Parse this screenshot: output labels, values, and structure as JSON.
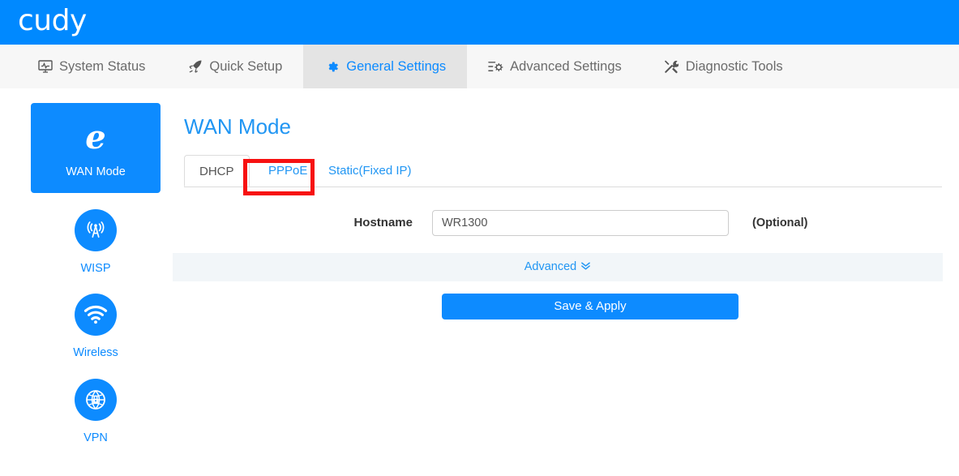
{
  "brand": {
    "name": "cudy"
  },
  "nav": {
    "items": [
      {
        "label": "System Status",
        "icon": "monitor-pulse-icon",
        "active": false
      },
      {
        "label": "Quick Setup",
        "icon": "rocket-icon",
        "active": false
      },
      {
        "label": "General Settings",
        "icon": "gear-icon",
        "active": true
      },
      {
        "label": "Advanced Settings",
        "icon": "sliders-gear-icon",
        "active": false
      },
      {
        "label": "Diagnostic Tools",
        "icon": "wrench-screwdriver-icon",
        "active": false
      }
    ]
  },
  "sidebar": {
    "items": [
      {
        "label": "WAN Mode",
        "icon": "browser-e-icon",
        "active": true
      },
      {
        "label": "WISP",
        "icon": "antenna-icon",
        "active": false
      },
      {
        "label": "Wireless",
        "icon": "wifi-icon",
        "active": false
      },
      {
        "label": "VPN",
        "icon": "globe-lock-icon",
        "active": false
      }
    ]
  },
  "main": {
    "title": "WAN Mode",
    "tabs": [
      {
        "label": "DHCP",
        "active": true,
        "highlighted": false
      },
      {
        "label": "PPPoE",
        "active": false,
        "highlighted": true
      },
      {
        "label": "Static(Fixed IP)",
        "active": false,
        "highlighted": false
      }
    ],
    "form": {
      "hostname_label": "Hostname",
      "hostname_value": "WR1300",
      "hostname_placeholder": "",
      "hostname_hint": "(Optional)"
    },
    "advanced_label": "Advanced",
    "advanced_chevron": "»",
    "save_label": "Save & Apply"
  },
  "colors": {
    "brand_blue": "#0089ff",
    "accent_blue": "#0d8bff",
    "link_blue": "#2196f3",
    "nav_bg": "#f7f7f7",
    "nav_active_bg": "#e4e4e4",
    "advanced_bg": "#f2f6f9",
    "highlight_red": "#f71111"
  }
}
